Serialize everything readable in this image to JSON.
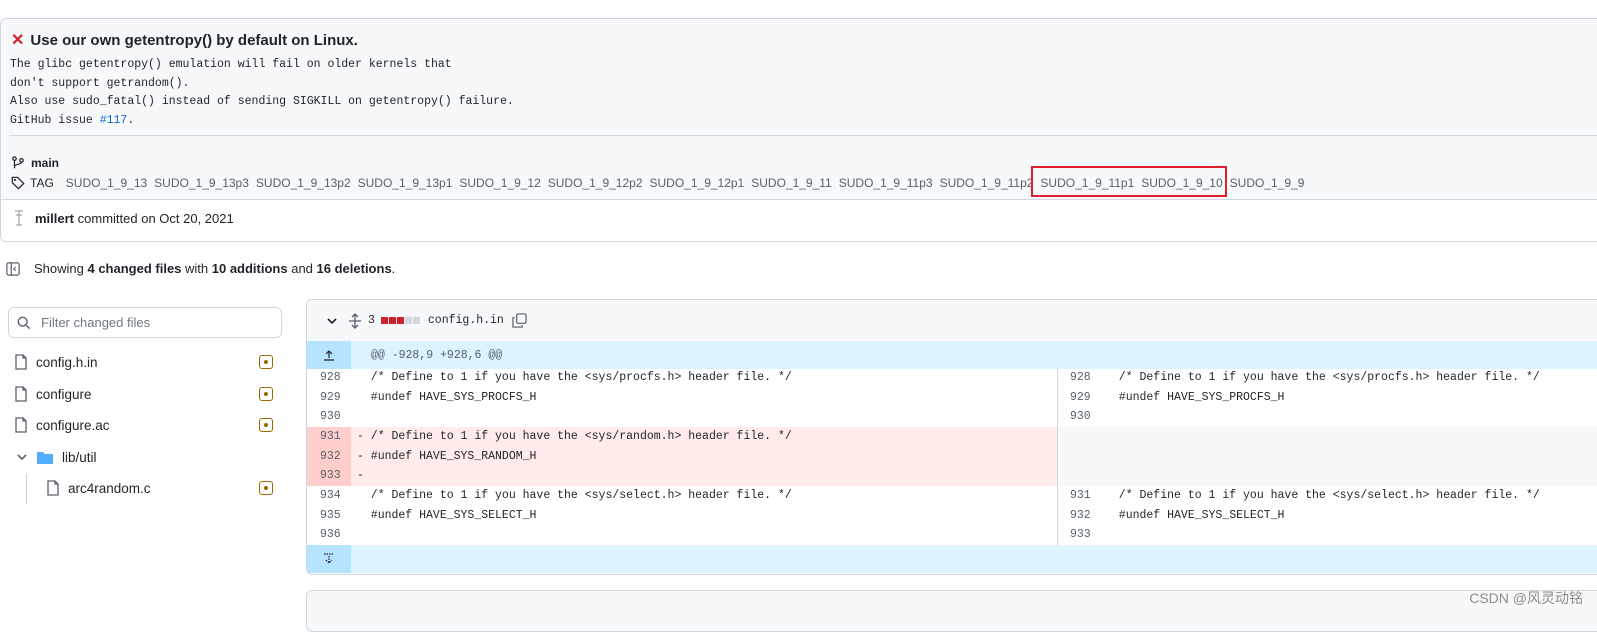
{
  "commit": {
    "title": "Use our own getentropy() by default on Linux.",
    "message_lines": [
      "The glibc getentropy() emulation will fail on older kernels that",
      "don't support getrandom().",
      "Also use sudo_fatal() instead of sending SIGKILL on getentropy() failure."
    ],
    "issue_prefix": "GitHub issue ",
    "issue_link": "#117",
    "issue_suffix": ".",
    "branch": "main",
    "tag_label": "TAG",
    "tags": [
      "SUDO_1_9_13",
      "SUDO_1_9_13p3",
      "SUDO_1_9_13p2",
      "SUDO_1_9_13p1",
      "SUDO_1_9_12",
      "SUDO_1_9_12p2",
      "SUDO_1_9_12p1",
      "SUDO_1_9_11",
      "SUDO_1_9_11p3",
      "SUDO_1_9_11p2",
      "SUDO_1_9_11p1",
      "SUDO_1_9_10",
      "SUDO_1_9_9"
    ],
    "author": "millert",
    "committed_text": "committed on Oct 20, 2021"
  },
  "summary": {
    "prefix": "Showing ",
    "files": "4 changed files",
    "mid1": " with ",
    "additions": "10 additions",
    "mid2": " and ",
    "deletions": "16 deletions",
    "suffix": "."
  },
  "file_tree": {
    "filter_placeholder": "Filter changed files",
    "items": [
      {
        "name": "config.h.in",
        "type": "file",
        "status": "modified"
      },
      {
        "name": "configure",
        "type": "file",
        "status": "modified"
      },
      {
        "name": "configure.ac",
        "type": "file",
        "status": "modified"
      },
      {
        "name": "lib/util",
        "type": "folder"
      },
      {
        "name": "arc4random.c",
        "type": "file",
        "status": "modified"
      }
    ]
  },
  "diff": {
    "file_name": "config.h.in",
    "change_count": "3",
    "diffstat": [
      "red",
      "red",
      "red",
      "grey",
      "grey"
    ],
    "hunk_header": "@@ -928,9 +928,6 @@",
    "rows": [
      {
        "l_num": "928",
        "l_code": "  /* Define to 1 if you have the <sys/procfs.h> header file. */",
        "r_num": "928",
        "r_code": "  /* Define to 1 if you have the <sys/procfs.h> header file. */"
      },
      {
        "l_num": "929",
        "l_code": "  #undef HAVE_SYS_PROCFS_H",
        "r_num": "929",
        "r_code": "  #undef HAVE_SYS_PROCFS_H"
      },
      {
        "l_num": "930",
        "l_code": "",
        "r_num": "930",
        "r_code": ""
      },
      {
        "l_num": "931",
        "l_code": "- /* Define to 1 if you have the <sys/random.h> header file. */",
        "r_num": "",
        "r_code": ""
      },
      {
        "l_num": "932",
        "l_code": "- #undef HAVE_SYS_RANDOM_H",
        "r_num": "",
        "r_code": ""
      },
      {
        "l_num": "933",
        "l_code": "-",
        "r_num": "",
        "r_code": ""
      },
      {
        "l_num": "934",
        "l_code": "  /* Define to 1 if you have the <sys/select.h> header file. */",
        "r_num": "931",
        "r_code": "  /* Define to 1 if you have the <sys/select.h> header file. */"
      },
      {
        "l_num": "935",
        "l_code": "  #undef HAVE_SYS_SELECT_H",
        "r_num": "932",
        "r_code": "  #undef HAVE_SYS_SELECT_H"
      },
      {
        "l_num": "936",
        "l_code": "",
        "r_num": "933",
        "r_code": ""
      }
    ]
  },
  "watermark": "CSDN @风灵动铭",
  "colors": {
    "deleted_bg": "#ffebe9",
    "hunk_bg": "#ddf4ff",
    "highlight_box": "#e0212d",
    "link": "#0969da"
  }
}
